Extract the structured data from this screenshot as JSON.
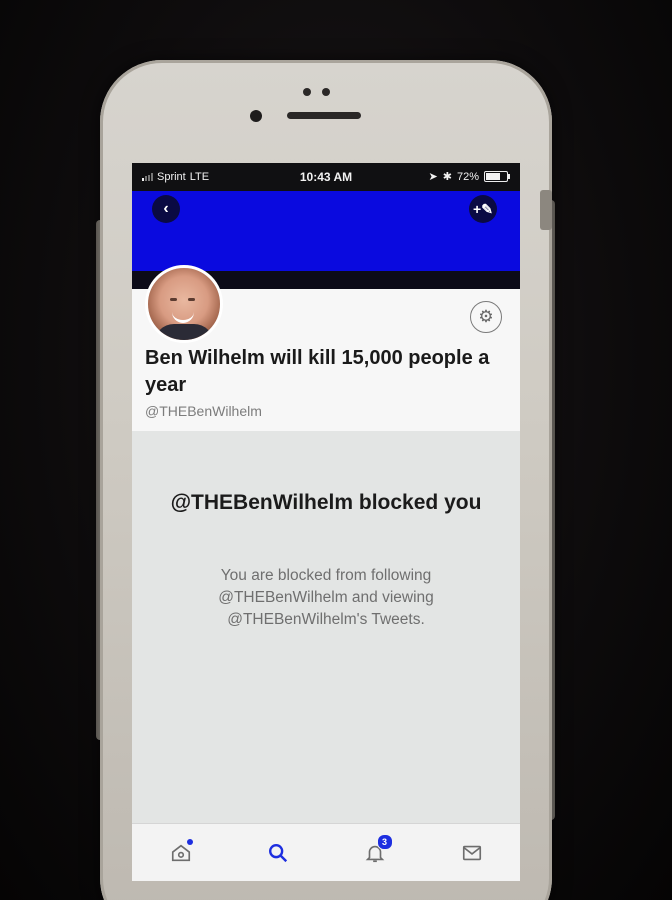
{
  "status_bar": {
    "carrier": "Sprint",
    "network": "LTE",
    "time": "10:43 AM",
    "battery": "72%",
    "battery_level": 0.72
  },
  "header": {
    "back_icon": "chevron-left-icon",
    "compose_icon": "compose-tweet-icon",
    "banner_color": "#0a0adf"
  },
  "profile": {
    "name": "Ben Wilhelm will kill 15,000 people a year",
    "handle": "@THEBenWilhelm",
    "settings_icon": "gear-icon"
  },
  "blocked": {
    "title": "@THEBenWilhelm blocked you",
    "message": "You are blocked from following @THEBenWilhelm and viewing @THEBenWilhelm's Tweets."
  },
  "tab_bar": {
    "items": [
      {
        "icon": "home-icon",
        "has_dot": true
      },
      {
        "icon": "search-icon",
        "active": true
      },
      {
        "icon": "notifications-icon",
        "badge": "3"
      },
      {
        "icon": "messages-icon"
      }
    ],
    "accent": "#1d2ee0"
  }
}
